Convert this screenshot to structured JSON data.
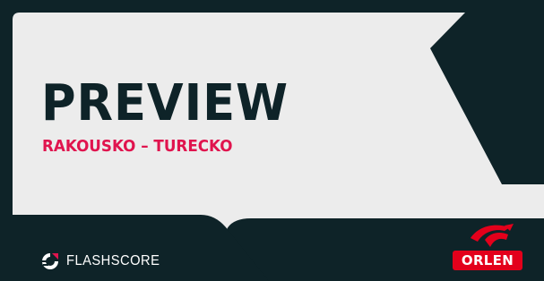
{
  "heading": {
    "title": "PREVIEW",
    "match": "RAKOUSKO – TURECKO"
  },
  "branding": {
    "logo_icon": "flashscore-logo-icon",
    "name": "FLASHSCORE"
  },
  "sponsor": {
    "logo_icon": "orlen-eagle-icon",
    "name": "ORLEN"
  },
  "colors": {
    "background_dark": "#0e2328",
    "panel_light": "#ececec",
    "accent_pink": "#e0144e",
    "sponsor_red": "#e3001b"
  }
}
